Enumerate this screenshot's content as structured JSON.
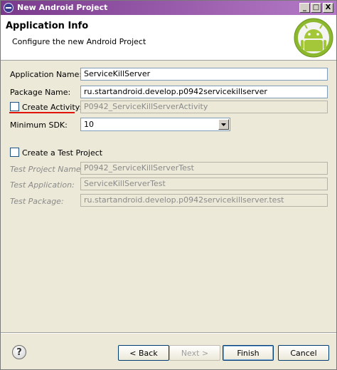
{
  "window": {
    "title": "New Android Project"
  },
  "titlebar_buttons": {
    "minimize": "_",
    "maximize": "□",
    "close": "X"
  },
  "header": {
    "title": "Application Info",
    "description": "Configure the new Android Project"
  },
  "form": {
    "application_name": {
      "label": "Application Name:",
      "value": "ServiceKillServer"
    },
    "package_name": {
      "label": "Package Name:",
      "value": "ru.startandroid.develop.p0942servicekillserver"
    },
    "create_activity": {
      "label": "Create Activity:",
      "checked": false,
      "value": "P0942_ServiceKillServerActivity"
    },
    "minimum_sdk": {
      "label": "Minimum SDK:",
      "value": "10"
    }
  },
  "test_project": {
    "checkbox_label": "Create a Test Project",
    "checked": false,
    "test_project_name": {
      "label": "Test Project Name:",
      "value": "P0942_ServiceKillServerTest"
    },
    "test_application": {
      "label": "Test Application:",
      "value": "ServiceKillServerTest"
    },
    "test_package": {
      "label": "Test Package:",
      "value": "ru.startandroid.develop.p0942servicekillserver.test"
    }
  },
  "footer": {
    "help": "?",
    "back": "< Back",
    "next": "Next >",
    "finish": "Finish",
    "cancel": "Cancel"
  },
  "colors": {
    "accent_underline": "#e0140a",
    "android_green": "#a4c639"
  }
}
